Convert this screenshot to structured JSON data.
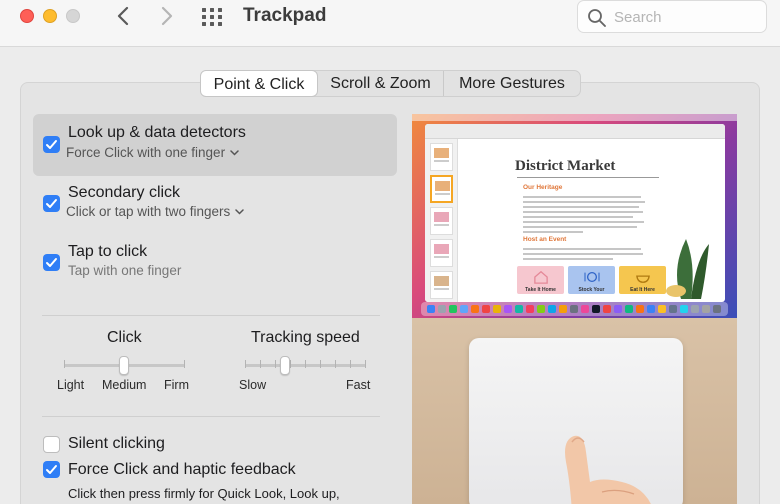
{
  "window": {
    "title": "Trackpad"
  },
  "search": {
    "placeholder": "Search"
  },
  "tabs": [
    {
      "label": "Point & Click",
      "active": true
    },
    {
      "label": "Scroll & Zoom",
      "active": false
    },
    {
      "label": "More Gestures",
      "active": false
    }
  ],
  "options": {
    "lookup": {
      "title": "Look up & data detectors",
      "sub": "Force Click with one finger",
      "checked": true
    },
    "secondary": {
      "title": "Secondary click",
      "sub": "Click or tap with two fingers",
      "checked": true
    },
    "tap": {
      "title": "Tap to click",
      "sub": "Tap with one finger",
      "checked": true
    },
    "silent": {
      "title": "Silent clicking",
      "checked": false
    },
    "force": {
      "title": "Force Click and haptic feedback",
      "checked": true,
      "help": "Click then press firmly for Quick Look, Look up,"
    }
  },
  "click_slider": {
    "title": "Click",
    "labels": [
      "Light",
      "Medium",
      "Firm"
    ],
    "value": "Medium"
  },
  "tracking_slider": {
    "title": "Tracking speed",
    "min_label": "Slow",
    "max_label": "Fast",
    "value_fraction": 0.33
  },
  "preview": {
    "doc_title": "District Market",
    "heading1": "Our Heritage",
    "heading2": "Host an Event",
    "cards": [
      "Take It Home",
      "Stock Your",
      "Eat It Here"
    ]
  },
  "colors": {
    "accent": "#2f7ef6",
    "selected_row": "#d1d1d1"
  }
}
